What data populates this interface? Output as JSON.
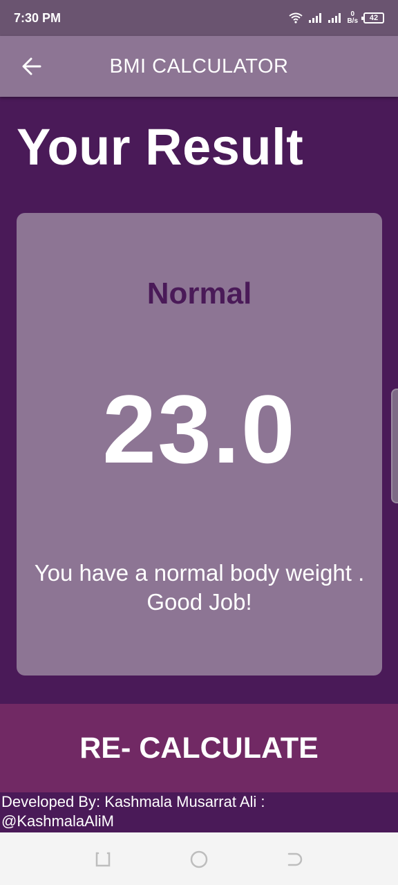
{
  "status_bar": {
    "time": "7:30 PM",
    "net_speed_value": "0",
    "net_speed_unit": "B/s",
    "battery": "42"
  },
  "app_bar": {
    "title": "BMI CALCULATOR",
    "back_icon": "arrow-left-icon"
  },
  "page": {
    "heading": "Your Result"
  },
  "result": {
    "category": "Normal",
    "bmi": "23.0",
    "message": "You have a normal body weight . Good Job!"
  },
  "actions": {
    "recalculate_label": "RE- CALCULATE"
  },
  "footer": {
    "line1": "Developed By: Kashmala Musarrat Ali :",
    "line2": "@KashmalaAliM"
  },
  "colors": {
    "background": "#4a1a58",
    "card": "#8d7594",
    "app_bar": "#8d7594",
    "button": "#712964",
    "category_text": "#4a1a58"
  },
  "nav_bar": {
    "recents_icon": "recents-icon",
    "home_icon": "home-circle-icon",
    "back_icon": "back-icon"
  }
}
